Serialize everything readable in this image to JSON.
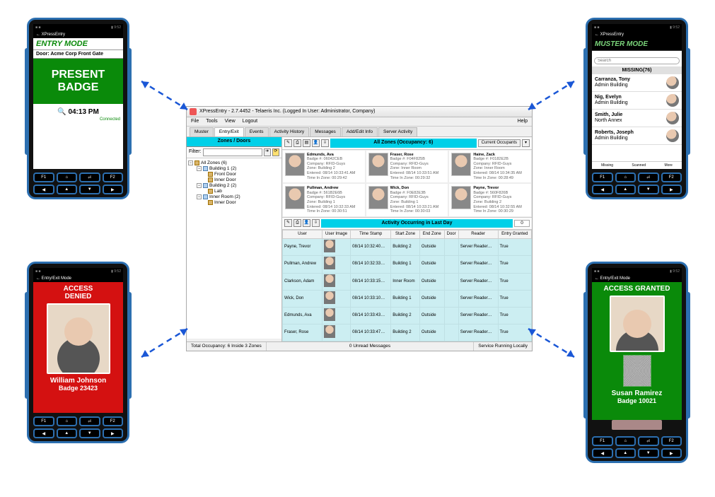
{
  "devices": {
    "entry": {
      "appbar_title": "XPressEntry",
      "mode_label": "ENTRY MODE",
      "door_label": "Door: Acme Corp Front Gate",
      "present_label": "PRESENT\nBADGE",
      "time": "04:13 PM",
      "connection": "Connected"
    },
    "muster": {
      "appbar_title": "XPressEntry",
      "mode_label": "MUSTER MODE",
      "search_placeholder": "Search",
      "missing_label": "MISSING(76)",
      "people": [
        {
          "name": "Carranza, Tony",
          "loc": "Admin Building"
        },
        {
          "name": "Nig, Evelyn",
          "loc": "Admin Building"
        },
        {
          "name": "Smith, Julie",
          "loc": "North Annex"
        },
        {
          "name": "Roberts, Joseph",
          "loc": "Admin Building"
        }
      ],
      "tabs": [
        "Missing",
        "Scanned",
        "More"
      ]
    },
    "denied": {
      "appbar_title": "Entry/Exit Mode",
      "status": "ACCESS\nDENIED",
      "name": "William Johnson",
      "badge": "Badge 23423"
    },
    "granted": {
      "appbar_title": "Entry/Exit Mode",
      "status": "ACCESS GRANTED",
      "name": "Susan Ramirez",
      "badge": "Badge 10021"
    }
  },
  "desktop": {
    "title": "XPressEntry - 2.7.4452 - Telaeris Inc. (Logged In User: Administrator, Company)",
    "menus": [
      "File",
      "Tools",
      "View",
      "Logout"
    ],
    "help": "Help",
    "tabs": [
      "Muster",
      "Entry/Exit",
      "Events",
      "Activity History",
      "Messages",
      "Add/Edit Info",
      "Server Activity"
    ],
    "side_header": "Zones / Doors",
    "filter_label": "Filter:",
    "tree": {
      "root": "All Zones (6)",
      "nodes": [
        {
          "label": "Building 1 (2)",
          "children": [
            "Front Door",
            "Inner Door"
          ]
        },
        {
          "label": "Building 2 (2)",
          "children": [
            "Lab"
          ]
        },
        {
          "label": "Inner Room (2)",
          "children": [
            "Inner Door"
          ]
        }
      ]
    },
    "allzones_header": "All Zones (Occupancy: 6)",
    "current_occupants_btn": "Current Occupants",
    "occupants": [
      {
        "name": "Edmunds, Ava",
        "badge": "Badge #: 06042CEB",
        "company": "Company: RFID-Guys",
        "zone": "Zone: Building 2",
        "entered": "Entered: 08/14 10:33:41 AM",
        "tiz": "Time In Zone: 00:29:42"
      },
      {
        "name": "Fraser, Rose",
        "badge": "Badge #: F04F825B",
        "company": "Company: RFID-Guys",
        "zone": "Zone: Inner Room",
        "entered": "Entered: 08/14 10:33:51 AM",
        "tiz": "Time In Zone: 00:29:32"
      },
      {
        "name": "Haine, Zack",
        "badge": "Badge #: F0182E2B",
        "company": "Company: RFID-Guys",
        "zone": "Zone: Inner Room",
        "entered": "Entered: 08/14 10:34:35 AM",
        "tiz": "Time In Zone: 00:28:49"
      },
      {
        "name": "Pullman, Andrew",
        "badge": "Badge #: 561B2E6B",
        "company": "Company: RFID-Guys",
        "zone": "Zone: Building 1",
        "entered": "Entered: 08/14 10:32:33 AM",
        "tiz": "Time In Zone: 00:30:51"
      },
      {
        "name": "Wick, Don",
        "badge": "Badge #: F0E82E3B",
        "company": "Company: RFID-Guys",
        "zone": "Zone: Building 1",
        "entered": "Entered: 08/14 10:33:21 AM",
        "tiz": "Time In Zone: 00:30:03"
      },
      {
        "name": "Payne, Trevor",
        "badge": "Badge #: 560F826B",
        "company": "Company: RFID-Guys",
        "zone": "Zone: Building 2",
        "entered": "Entered: 08/14 10:32:55 AM",
        "tiz": "Time In Zone: 00:30:29"
      }
    ],
    "activity_header": "Activity Occurring in Last Day",
    "activity_count": "0",
    "activity_columns": [
      "User",
      "User Image",
      "Time Stamp",
      "Start Zone",
      "End Zone",
      "Door",
      "Reader",
      "Entry Granted"
    ],
    "activity_rows": [
      {
        "user": "Payne, Trevor",
        "time": "08/14 10:32:40…",
        "start": "Building 2",
        "end": "Outside",
        "door": "",
        "reader": "Server Reader…",
        "granted": "True"
      },
      {
        "user": "Pullman, Andrew",
        "time": "08/14 10:32:33…",
        "start": "Building 1",
        "end": "Outside",
        "door": "",
        "reader": "Server Reader…",
        "granted": "True"
      },
      {
        "user": "Clarkson, Adam",
        "time": "08/14 10:33:15…",
        "start": "Inner Room",
        "end": "Outside",
        "door": "",
        "reader": "Server Reader…",
        "granted": "True"
      },
      {
        "user": "Wick, Don",
        "time": "08/14 10:33:10…",
        "start": "Building 1",
        "end": "Outside",
        "door": "",
        "reader": "Server Reader…",
        "granted": "True"
      },
      {
        "user": "Edmunds, Ava",
        "time": "08/14 10:33:43…",
        "start": "Building 2",
        "end": "Outside",
        "door": "",
        "reader": "Server Reader…",
        "granted": "True"
      },
      {
        "user": "Fraser, Rose",
        "time": "08/14 10:33:47…",
        "start": "Building 2",
        "end": "Outside",
        "door": "",
        "reader": "Server Reader…",
        "granted": "True"
      }
    ],
    "status": {
      "left": "Total Occupancy: 6 Inside 3 Zones",
      "mid": "0 Unread Messages",
      "right": "Service Running Locally"
    }
  },
  "hw_buttons": {
    "row1": [
      "F1",
      "⌂",
      "⏎",
      "F2"
    ],
    "row2": [
      "◀",
      "▲",
      "▼",
      "▶"
    ]
  }
}
